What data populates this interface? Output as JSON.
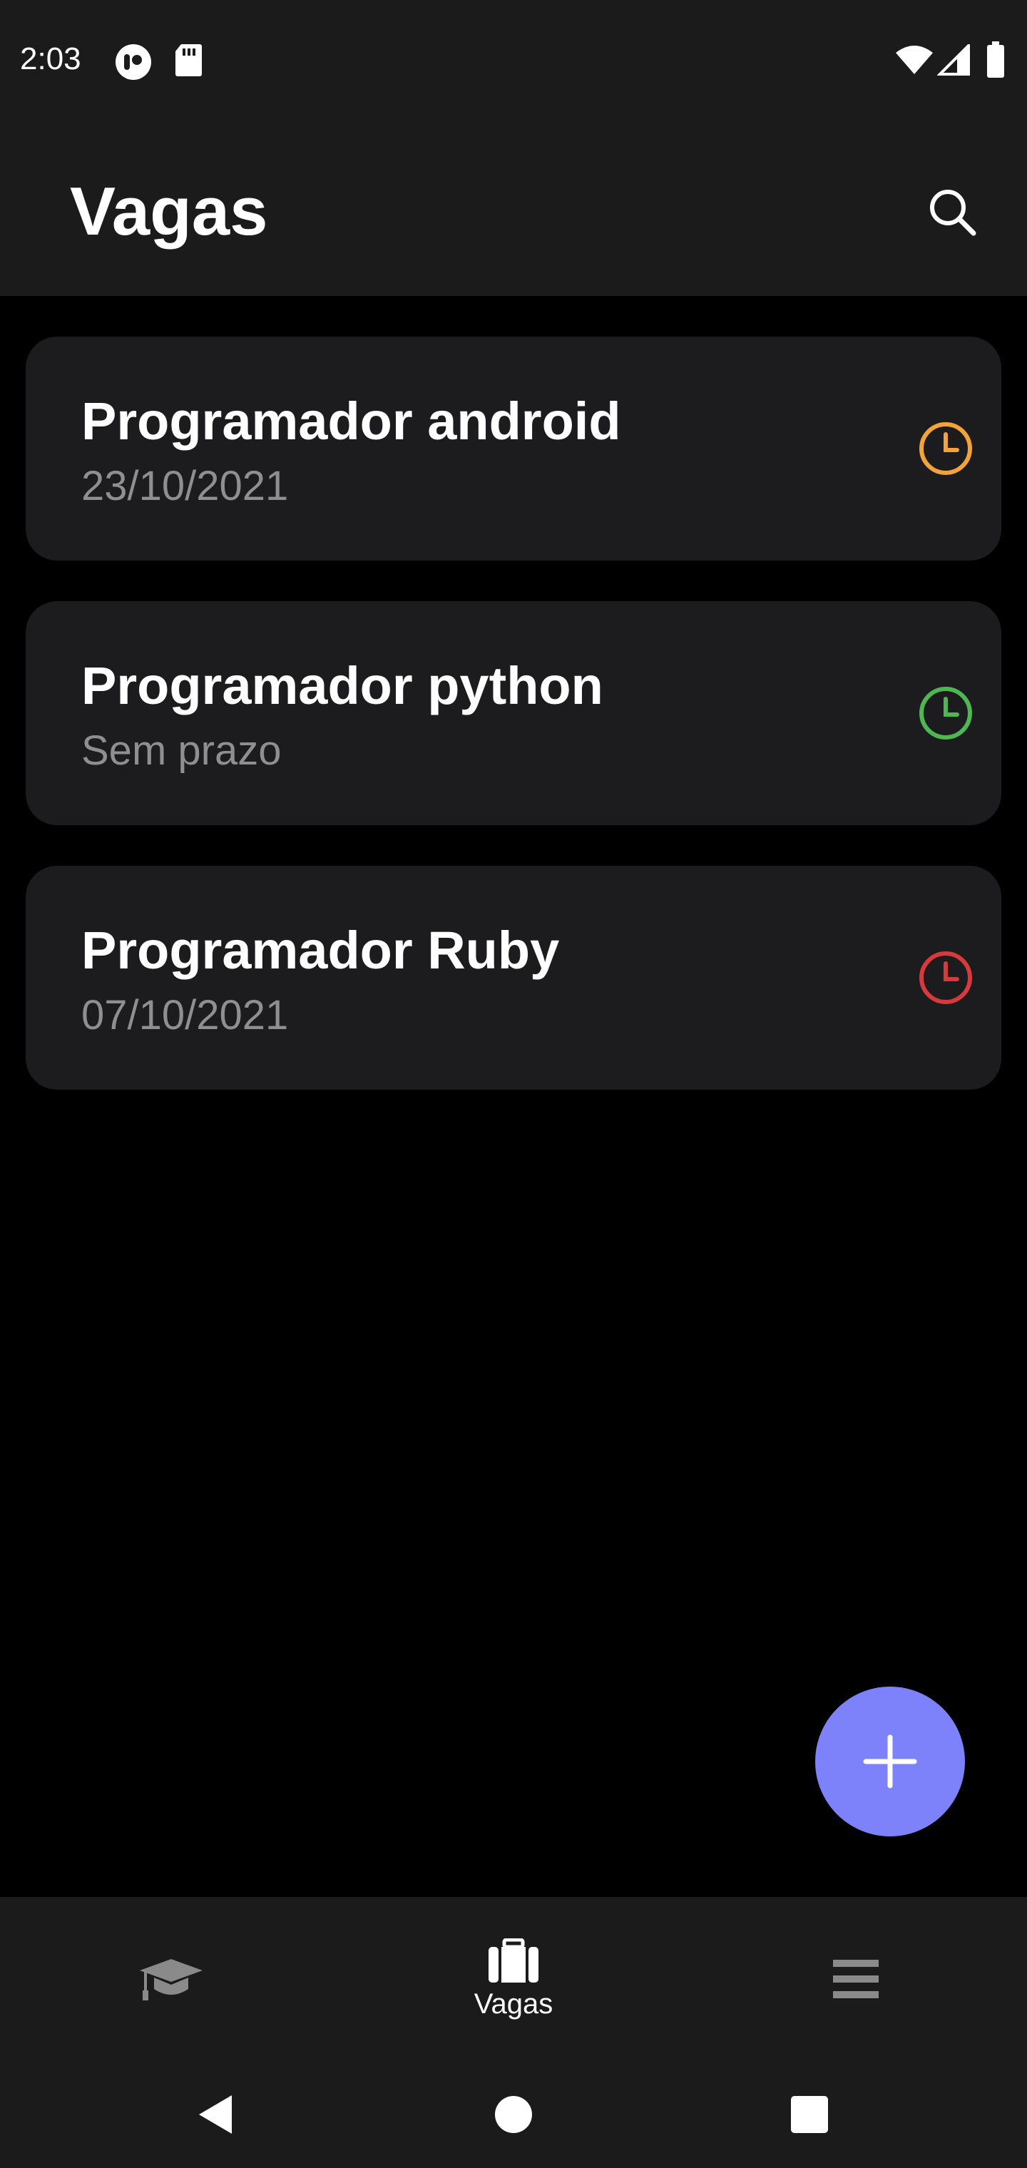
{
  "status_bar": {
    "time": "2:03",
    "left_icons": [
      "media-app-icon",
      "sd-card-icon"
    ],
    "right_icons": [
      "wifi-icon",
      "cell-signal-icon",
      "battery-icon"
    ]
  },
  "app_bar": {
    "title": "Vagas",
    "search_icon": "search-icon"
  },
  "jobs": [
    {
      "title": "Programador android",
      "subtitle": "23/10/2021",
      "status_icon": "clock-icon",
      "status_color": "#f2a33a"
    },
    {
      "title": "Programador python",
      "subtitle": "Sem prazo",
      "status_icon": "clock-icon",
      "status_color": "#4fb752"
    },
    {
      "title": "Programador Ruby",
      "subtitle": "07/10/2021",
      "status_icon": "clock-icon",
      "status_color": "#d8393a"
    }
  ],
  "fab": {
    "icon": "plus-icon",
    "color": "#7e82fa"
  },
  "bottom_nav": {
    "items": [
      {
        "icon": "graduation-cap-icon",
        "label": "",
        "active": false
      },
      {
        "icon": "briefcase-icon",
        "label": "Vagas",
        "active": true
      },
      {
        "icon": "menu-icon",
        "label": "",
        "active": false
      }
    ]
  },
  "system_nav": {
    "items": [
      "back-icon",
      "home-icon",
      "recents-icon"
    ]
  },
  "colors": {
    "background": "#000000",
    "surface": "#1b1b1b",
    "card": "#1c1c1e",
    "accent": "#7e82fa",
    "secondary_text": "#8f8f8f",
    "inactive_icon": "#8a8a8a"
  }
}
